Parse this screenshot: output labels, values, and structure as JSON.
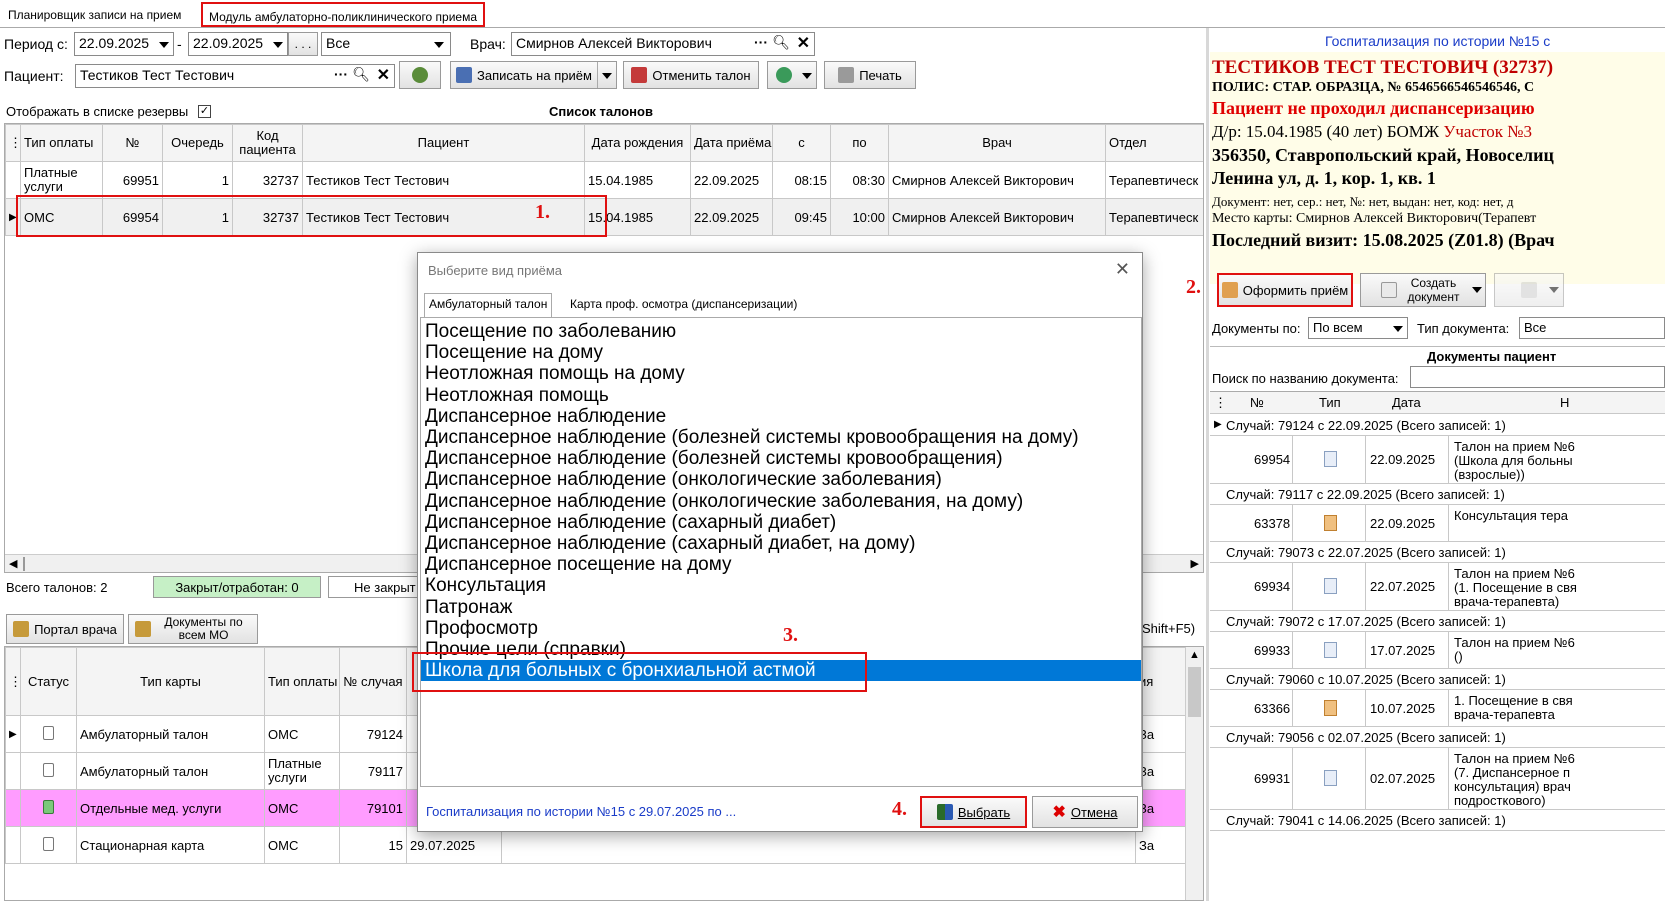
{
  "tabs": [
    {
      "label": "Планировщик записи на прием"
    },
    {
      "label": "Модуль амбулаторно-поликлинического приема"
    }
  ],
  "filters": {
    "period_label": "Период с:",
    "date_from": "22.09.2025",
    "dash": "-",
    "date_to": "22.09.2025",
    "ellipsis": ". . .",
    "status_value": "Все",
    "doctor_label": "Врач:",
    "doctor_value": "Смирнов Алексей Викторович",
    "patient_label": "Пациент:",
    "patient_value": "Тестиков Тест Тестович"
  },
  "toolbar": {
    "book_label": "Записать на приём",
    "cancel_label": "Отменить талон",
    "print_label": "Печать"
  },
  "reserves_label": "Отображать в списке резервы",
  "tickets": {
    "title": "Список талонов",
    "headers": [
      "Тип оплаты",
      "№",
      "Очередь",
      "Код пациента",
      "Пациент",
      "Дата рождения",
      "Дата приёма",
      "с",
      "по",
      "Врач",
      "Отдел"
    ],
    "rows": [
      [
        "Платные услуги",
        "69951",
        "1",
        "32737",
        "Тестиков Тест Тестович",
        "15.04.1985",
        "22.09.2025",
        "08:15",
        "08:30",
        "Смирнов Алексей Викторович",
        "Терапевтическ"
      ],
      [
        "ОМС",
        "69954",
        "1",
        "32737",
        "Тестиков Тест Тестович",
        "15.04.1985",
        "22.09.2025",
        "09:45",
        "10:00",
        "Смирнов Алексей Викторович",
        "Терапевтическ"
      ]
    ]
  },
  "summary": {
    "total": "Всего талонов: 2",
    "closed": "Закрыт/отработан: 0",
    "not_closed": "Не закрыт"
  },
  "bottom_toolbar": {
    "portal_label": "Портал врача",
    "docs_label": "Документы по всем МО",
    "shortcut": "Shift+F5)"
  },
  "cases": {
    "headers": [
      "Статус",
      "Тип карты",
      "Тип оплаты",
      "№ случая"
    ],
    "rows": [
      {
        "type": "Амбулаторный талон",
        "pay": "ОМС",
        "num": "79124",
        "date": "",
        "tail": "За"
      },
      {
        "type": "Амбулаторный талон",
        "pay": "Платные услуги",
        "num": "79117",
        "date": "",
        "tail": "За"
      },
      {
        "type": "Отдельные мед. услуги",
        "pay": "ОМС",
        "num": "79101",
        "date": "",
        "tail": "За"
      },
      {
        "type": "Стационарная карта",
        "pay": "ОМС",
        "num": "15",
        "date": "29.07.2025",
        "tail": "За"
      }
    ],
    "tail_header": "ия"
  },
  "dialog": {
    "title": "Выберите вид приёма",
    "tabs": [
      "Амбулаторный талон",
      "Карта проф. осмотра (диспансеризации)"
    ],
    "items": [
      "Посещение по заболеванию",
      "Посещение на дому",
      "Неотложная помощь на дому",
      "Неотложная помощь",
      "Диспансерное наблюдение",
      "Диспансерное наблюдение (болезней системы кровообращения на дому)",
      "Диспансерное наблюдение (болезней системы кровообращения)",
      "Диспансерное наблюдение (онкологические заболевания)",
      "Диспансерное наблюдение (онкологические заболевания, на дому)",
      "Диспансерное наблюдение (сахарный диабет)",
      "Диспансерное наблюдение (сахарный диабет, на дому)",
      "Диспансерное посещение на дому",
      "Консультация",
      "Патронаж",
      "Профосмотр",
      "Прочие цели (справки)",
      "Школа для больных с бронхиальной астмой"
    ],
    "selected_index": 16,
    "link": "Госпитализация по истории №15 с 29.07.2025 по ...",
    "ok_label": "Выбрать",
    "cancel_label": "Отмена"
  },
  "patient_panel": {
    "hosp_link": "Госпитализация по истории №15 с",
    "name": "ТЕСТИКОВ ТЕСТ ТЕСТОВИЧ (32737)",
    "policy": "ПОЛИС: СТАР. ОБРАЗЦА, № 6546566546546546, С",
    "warning": "Пациент не проходил диспансеризацию",
    "dob": "Д/р: 15.04.1985 (40 лет) БОМЖ ",
    "district": "Участок №3",
    "address1": "356350, Ставропольский край, Новоселиц",
    "address2": "Ленина ул, д. 1, кор. 1, кв. 1",
    "document": "Документ: нет, сер.: нет, №: нет, выдан: нет, код: нет, д",
    "card_place": "Место карты: Смирнов Алексей Викторович(Терапевт",
    "last_visit": "Последний визит: 15.08.2025 (Z01.8) (Врач",
    "receive_label": "Оформить приём",
    "create_doc_label": "Создать документ",
    "docs_by_label": "Документы по:",
    "docs_by_value": "По всем",
    "doc_type_label": "Тип документа:",
    "doc_type_value": "Все",
    "docs_title": "Документы пациент",
    "search_label": "Поиск по названию документа:",
    "doc_headers": [
      "№",
      "Тип",
      "Дата",
      "Н"
    ],
    "groups": [
      {
        "title": "Случай: 79124 с 22.09.2025  (Всего записей: 1)",
        "num": "69954",
        "date": "22.09.2025",
        "lines": [
          "Талон на прием №6",
          "(Школа для больны",
          "(взрослые))"
        ],
        "icon": "doc"
      },
      {
        "title": "Случай: 79117 с 22.09.2025  (Всего записей: 1)",
        "num": "63378",
        "date": "22.09.2025",
        "lines": [
          "Консультация тера"
        ],
        "icon": "pen"
      },
      {
        "title": "Случай: 79073 с 22.07.2025  (Всего записей: 1)",
        "num": "69934",
        "date": "22.07.2025",
        "lines": [
          "Талон на прием №6",
          "(1. Посещение в свя",
          "врача-терапевта)"
        ],
        "icon": "doc"
      },
      {
        "title": "Случай: 79072 с 17.07.2025  (Всего записей: 1)",
        "num": "69933",
        "date": "17.07.2025",
        "lines": [
          "Талон на прием №6",
          "()"
        ],
        "icon": "doc"
      },
      {
        "title": "Случай: 79060 с 10.07.2025  (Всего записей: 1)",
        "num": "63366",
        "date": "10.07.2025",
        "lines": [
          "1. Посещение в свя",
          "врача-терапевта"
        ],
        "icon": "pen"
      },
      {
        "title": "Случай: 79056 с 02.07.2025  (Всего записей: 1)",
        "num": "69931",
        "date": "02.07.2025",
        "lines": [
          "Талон на прием №6",
          "(7. Диспансерное п",
          "консультация) врач",
          "подросткового)"
        ],
        "icon": "doc"
      },
      {
        "title": "Случай: 79041 с 14.06.2025  (Всего записей: 1)",
        "num": "",
        "date": "",
        "lines": [],
        "icon": ""
      }
    ]
  },
  "annotations": [
    "1.",
    "2.",
    "3.",
    "4."
  ],
  "colors": {
    "selection": "#0078d7",
    "annotation": "#e01010",
    "closed_bg": "#c6f0c6",
    "highlight_row": "#ff9cff",
    "link": "#1a3cc8",
    "warning": "#e00000"
  }
}
